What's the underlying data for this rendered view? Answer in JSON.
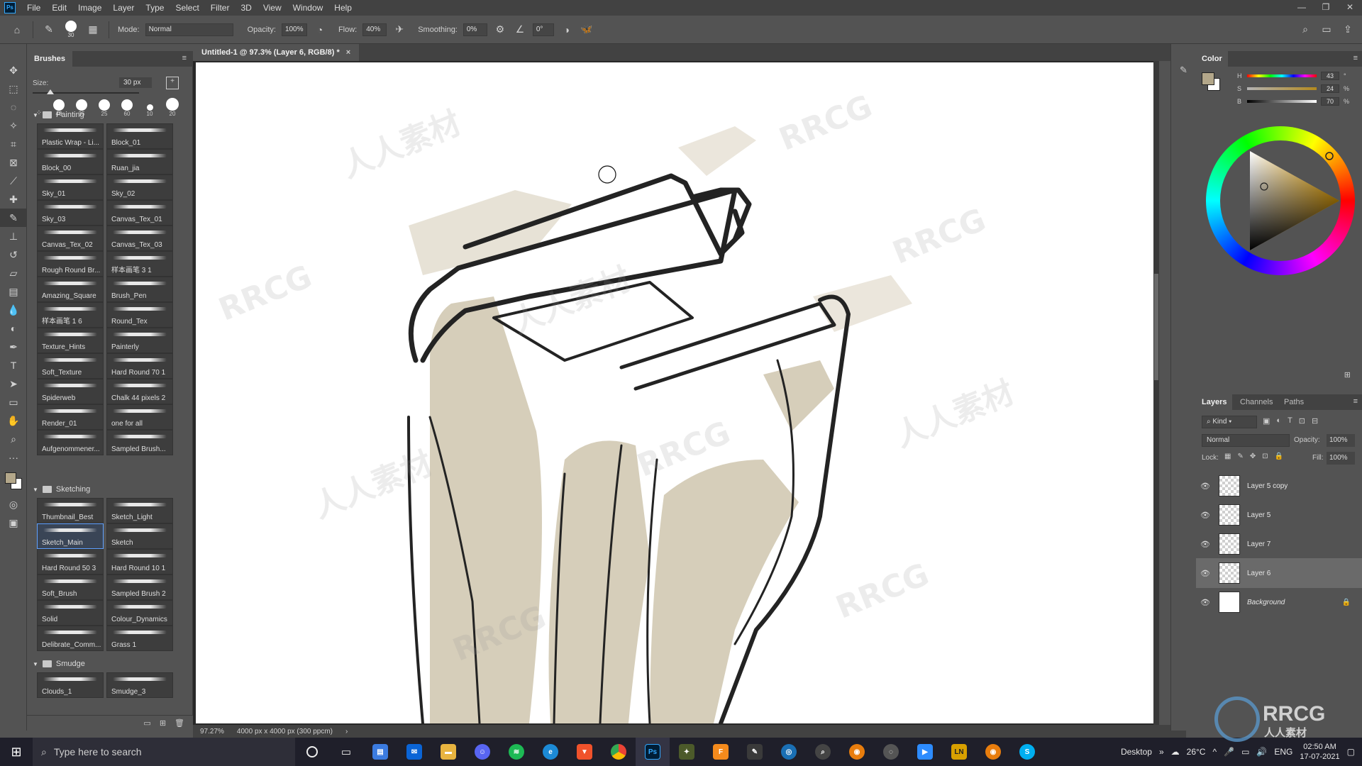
{
  "menubar": {
    "app_icon": "Ps",
    "items": [
      "File",
      "Edit",
      "Image",
      "Layer",
      "Type",
      "Select",
      "Filter",
      "3D",
      "View",
      "Window",
      "Help"
    ]
  },
  "options": {
    "brush_size": "30",
    "mode_label": "Mode:",
    "mode_value": "Normal",
    "opacity_label": "Opacity:",
    "opacity_value": "100%",
    "flow_label": "Flow:",
    "flow_value": "40%",
    "smoothing_label": "Smoothing:",
    "smoothing_value": "0%",
    "angle_value": "0°"
  },
  "brushes": {
    "panel_title": "Brushes",
    "size_label": "Size:",
    "size_value": "30 px",
    "presets": [
      "40",
      "35",
      "25",
      "60",
      "10",
      "20"
    ],
    "groups": [
      {
        "name": "Painting",
        "items": [
          "Plastic Wrap - Li...",
          "Block_01",
          "Block_00",
          "Ruan_jia",
          "Sky_01",
          "Sky_02",
          "Sky_03",
          "Canvas_Tex_01",
          "Canvas_Tex_02",
          "Canvas_Tex_03",
          "Rough Round Br...",
          "样本画笔 3 1",
          "Amazing_Square",
          "Brush_Pen",
          "样本画笔 1 6",
          "Round_Tex",
          "Texture_Hints",
          "Painterly",
          "Soft_Texture",
          "Hard Round 70 1",
          "Spiderweb",
          "Chalk 44 pixels 2",
          "Render_01",
          "one for all",
          "Aufgenommener...",
          "Sampled Brush..."
        ]
      },
      {
        "name": "Sketching",
        "items": [
          "Thumbnail_Best",
          "Sketch_Light",
          "Sketch_Main",
          "Sketch",
          "Hard Round 50 3",
          "Hard Round 10 1",
          "Soft_Brush",
          "Sampled Brush 2",
          "Solid",
          "Colour_Dynamics",
          "Delibrate_Comm...",
          "Grass 1"
        ]
      },
      {
        "name": "Smudge",
        "items": [
          "Clouds_1",
          "Smudge_3"
        ]
      }
    ],
    "selected": "Sketch_Main"
  },
  "document": {
    "tab_title": "Untitled-1 @ 97.3% (Layer 6, RGB/8) *",
    "zoom": "97.27%",
    "doc_info": "4000 px x 4000 px (300 ppcm)"
  },
  "color_panel": {
    "title": "Color",
    "h_label": "H",
    "h_value": "43",
    "s_label": "S",
    "s_value": "24",
    "b_label": "B",
    "b_value": "70",
    "percent": "%",
    "foreground_color": "#b3a78a",
    "background_color": "#ffffff"
  },
  "layers_panel": {
    "tabs": [
      "Layers",
      "Channels",
      "Paths"
    ],
    "kind_label": "Kind",
    "blend_mode": "Normal",
    "opacity_label": "Opacity:",
    "opacity_value": "100%",
    "lock_label": "Lock:",
    "fill_label": "Fill:",
    "fill_value": "100%",
    "layers": [
      "Layer 5 copy",
      "Layer 5",
      "Layer 7",
      "Layer 6",
      "Background"
    ],
    "selected": "Layer 6"
  },
  "taskbar": {
    "search_placeholder": "Type here to search",
    "desktop_label": "Desktop",
    "temperature": "26°C",
    "language": "ENG",
    "time": "02:50 AM",
    "date": "17-07-2021"
  },
  "watermark": "RRCG",
  "watermark_cn": "人人素材"
}
